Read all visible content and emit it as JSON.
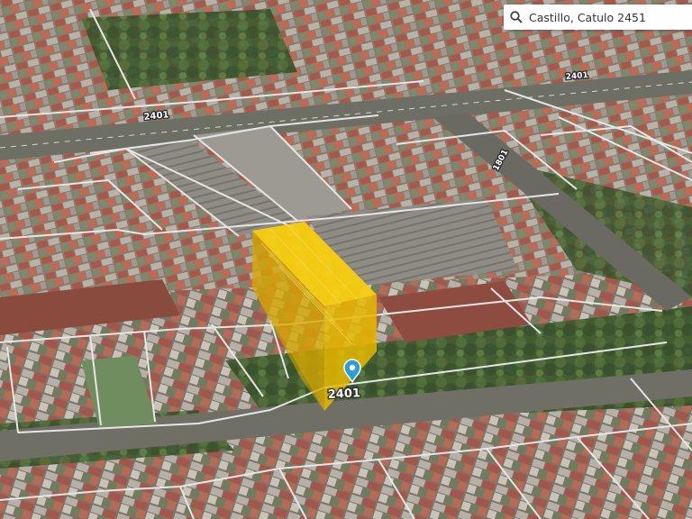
{
  "search": {
    "value": "Castillo, Catulo 2451",
    "icon": "search-icon"
  },
  "map": {
    "street_labels": [
      "2401",
      "2401",
      "1801"
    ],
    "marker": {
      "icon": "location-pin-icon",
      "label": "2401",
      "color": "#2a9fd6"
    },
    "building_highlight_color": "#f5c400",
    "parcel_line_color": "#e6e6e6"
  }
}
